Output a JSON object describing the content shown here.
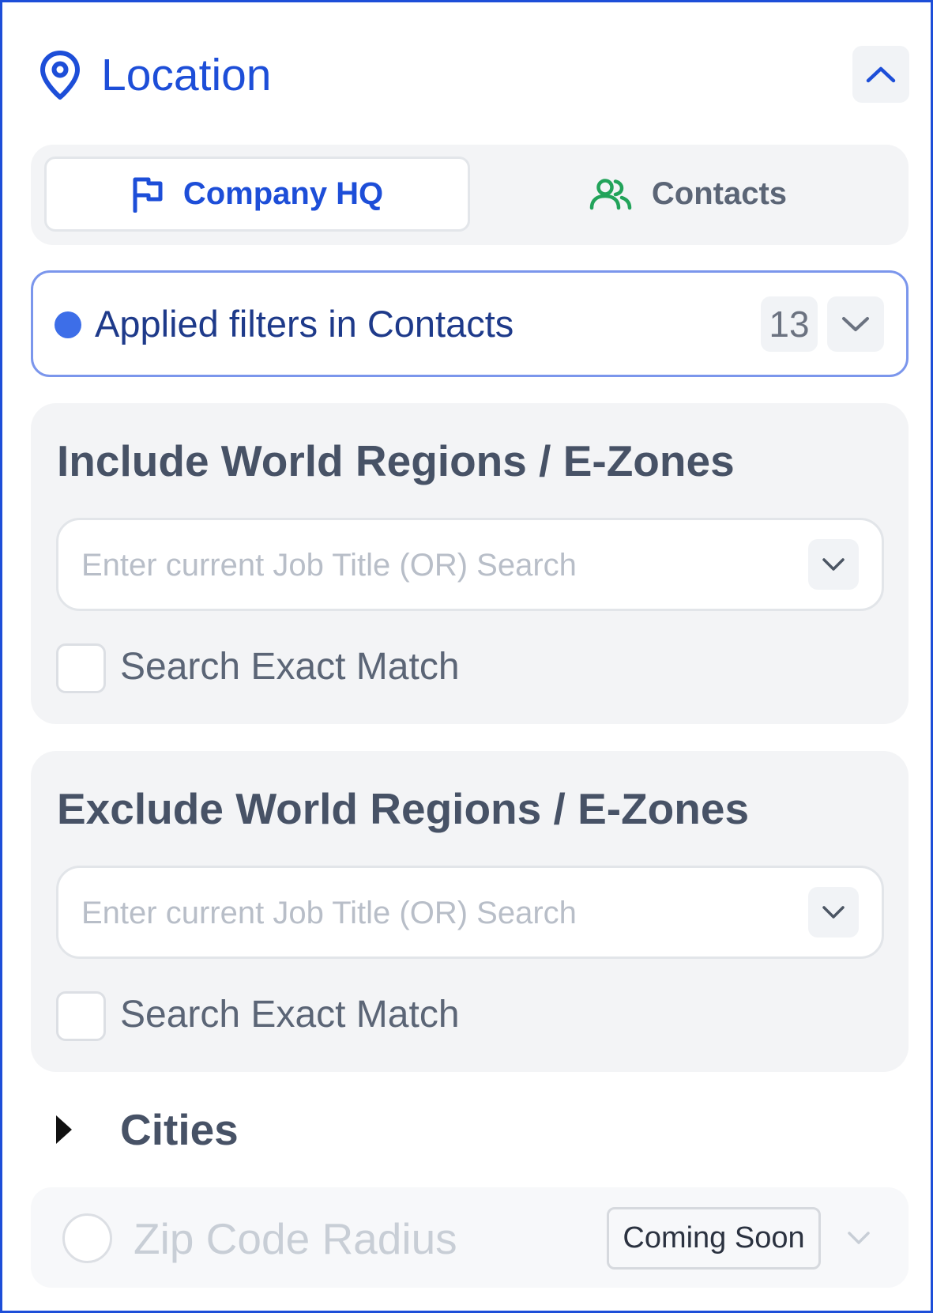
{
  "section": {
    "title": "Location",
    "icons": {
      "title": "map-pin-icon",
      "collapse": "chevron-up-icon"
    }
  },
  "toggle": {
    "company_hq": {
      "label": "Company HQ",
      "icon": "flag-icon",
      "active": true
    },
    "contacts": {
      "label": "Contacts",
      "icon": "users-icon",
      "active": false
    }
  },
  "applied_filters": {
    "label": "Applied filters in Contacts",
    "count": "13",
    "icon": "chevron-down-icon"
  },
  "include": {
    "title": "Include World Regions / E-Zones",
    "value": "",
    "placeholder": "Enter current Job Title (OR) Search",
    "exact_match_label": "Search Exact Match",
    "exact_match_checked": false
  },
  "exclude": {
    "title": "Exclude World Regions / E-Zones",
    "value": "",
    "placeholder": "Enter current Job Title (OR) Search",
    "exact_match_label": "Search Exact Match",
    "exact_match_checked": false
  },
  "cities": {
    "label": "Cities",
    "expanded": false
  },
  "zip_radius": {
    "label": "Zip Code Radius",
    "badge": "Coming Soon",
    "selected": false
  },
  "colors": {
    "accent": "#1d4ed8",
    "contacts_icon": "#22a35a",
    "applied_border": "#7b96ec",
    "dot": "#3d6ee8"
  }
}
